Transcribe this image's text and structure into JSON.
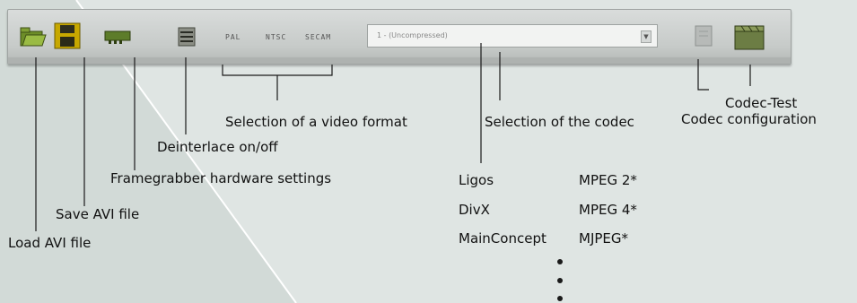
{
  "toolbar": {
    "video_formats": [
      "PAL",
      "NTSC",
      "SECAM"
    ],
    "codec_select_value": "1 - (Uncompressed)"
  },
  "labels": {
    "codec_test": "Codec-Test",
    "codec_configuration": "Codec configuration",
    "selection_video_format": "Selection of a video format",
    "selection_codec": "Selection of the codec",
    "deinterlace": "Deinterlace on/off",
    "framegrabber": "Framegrabber hardware settings",
    "save_avi": "Save AVI file",
    "load_avi": "Load AVI file"
  },
  "codec_list": [
    {
      "vendor": "Ligos",
      "format": "MPEG 2*"
    },
    {
      "vendor": "DivX",
      "format": "MPEG 4*"
    },
    {
      "vendor": "MainConcept",
      "format": "MJPEG*"
    }
  ],
  "colors": {
    "background": "#dfe5e3",
    "toolbar": "#c6cac8",
    "icon_green": "#6f8f2a",
    "icon_yellow": "#c8b000"
  }
}
